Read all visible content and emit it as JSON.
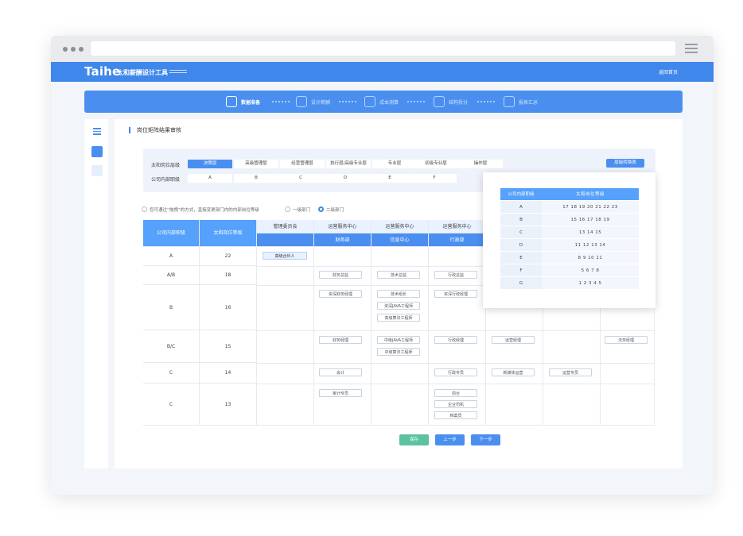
{
  "app": {
    "logo": "Taihe",
    "logo_cn": "太和薪酬设计工具",
    "home_link": "返回首页"
  },
  "steps": [
    {
      "label": "数据准备",
      "icon": "layers-icon",
      "active": true
    },
    {
      "label": "设计薪酬",
      "icon": "hexagon-icon",
      "active": false
    },
    {
      "label": "成本测算",
      "icon": "shield-yen-icon",
      "active": false
    },
    {
      "label": "结构拆分",
      "icon": "structure-icon",
      "active": false
    },
    {
      "label": "报表汇总",
      "icon": "report-icon",
      "active": false
    }
  ],
  "page": {
    "title": "岗位矩阵结果审核"
  },
  "filter": {
    "row1_label": "太和岗位层级",
    "row1_pills": [
      "决策层",
      "高级管理层",
      "经营管理层",
      "执行层/高级专业层",
      "专业层",
      "初级专业层",
      "操作层"
    ],
    "row2_label": "公司内部职级",
    "row2_pills": [
      "A",
      "B",
      "C",
      "D",
      "E",
      "F"
    ],
    "convert_button": "层级转换表"
  },
  "hint": {
    "text": "您可通过“拖拽”的方式，直接变更部门内的内部岗位等级",
    "option1": "一级部门",
    "option2": "二级部门"
  },
  "table": {
    "col1": "公司内部职级",
    "col2": "太和岗位等级",
    "dept_l1": [
      "管理委员会",
      "运营服务中心",
      "运营服务中心",
      "运营服务中心"
    ],
    "dept_l2": [
      "",
      "财务部",
      "信息中心",
      "行政部"
    ],
    "rows": [
      {
        "grade": "A",
        "level": "22"
      },
      {
        "grade": "A/B",
        "level": "18"
      },
      {
        "grade": "B",
        "level": "16"
      },
      {
        "grade": "B/C",
        "level": "15"
      },
      {
        "grade": "C",
        "level": "14"
      },
      {
        "grade": "C",
        "level": "13"
      }
    ],
    "tags": {
      "partner": "高级合伙人",
      "fin_director": "财务总监",
      "tech_director": "技术总监",
      "admin_director": "行政总监",
      "senior_fin_manager": "资深财务经理",
      "tech_lead": "技术组长",
      "senior_java": "资深JAVA工程师",
      "senior_algo": "高级算法工程师",
      "senior_admin_manager": "资深行政经理",
      "fin_manager": "财务经理",
      "mid_java": "中级JAVA工程师",
      "mid_algo": "中级算法工程师",
      "admin_manager": "行政经理",
      "ops_manager": "运营经理",
      "legal_manager": "法务经理",
      "accountant": "会计",
      "admin_specialist": "行政专员",
      "new_media_ops": "新媒体运营",
      "ops_specialist": "运营专员",
      "audit_specialist": "审计专员",
      "receptionist": "前台",
      "driver": "企业司机",
      "archivist": "档案员"
    }
  },
  "popup": {
    "head_k": "公司内部职级",
    "head_v": "太和岗位等级",
    "rows": [
      {
        "k": "A",
        "v": "17 18 19 20 21 22 23"
      },
      {
        "k": "B",
        "v": "15 16 17 18 19"
      },
      {
        "k": "C",
        "v": "13 14 15"
      },
      {
        "k": "D",
        "v": "11 12 13 14"
      },
      {
        "k": "E",
        "v": "8 9 10 11"
      },
      {
        "k": "F",
        "v": "5 6 7 8"
      },
      {
        "k": "G",
        "v": "1 2 3 4 5"
      }
    ]
  },
  "buttons": {
    "save": "保存",
    "prev": "上一步",
    "next": "下一步"
  },
  "colors": {
    "primary": "#3f87ea",
    "header_blue": "#55a1fb",
    "save_green": "#5cc3a1"
  }
}
